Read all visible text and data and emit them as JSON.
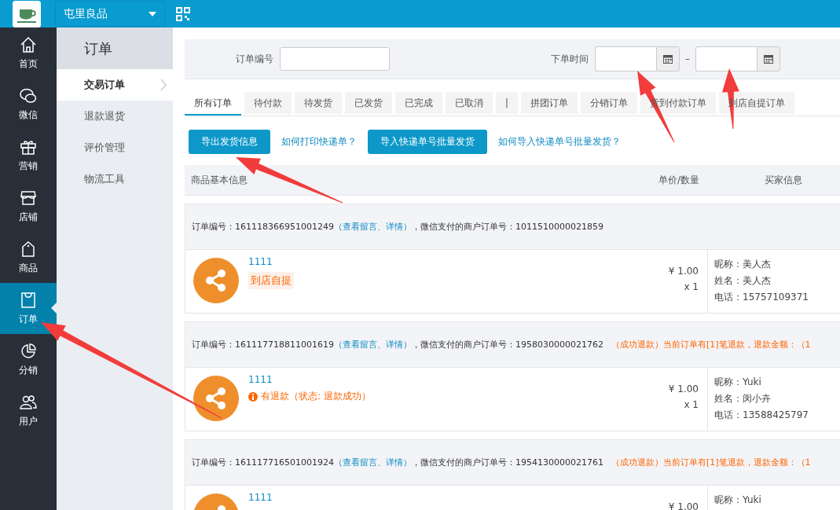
{
  "topbar": {
    "shop_name": "屯里良品"
  },
  "nav": [
    {
      "label": "首页",
      "kind": "home",
      "selected": false
    },
    {
      "label": "微信",
      "kind": "chat",
      "selected": false
    },
    {
      "label": "营销",
      "kind": "gift",
      "selected": false
    },
    {
      "label": "店铺",
      "kind": "store",
      "selected": false
    },
    {
      "label": "商品",
      "kind": "tag",
      "selected": false
    },
    {
      "label": "订单",
      "kind": "bag",
      "selected": true
    },
    {
      "label": "分销",
      "kind": "pie",
      "selected": false
    },
    {
      "label": "用户",
      "kind": "users",
      "selected": false
    }
  ],
  "subnav": {
    "title": "订单",
    "items": [
      {
        "label": "交易订单",
        "selected": true
      },
      {
        "label": "退款退货",
        "selected": false
      },
      {
        "label": "评价管理",
        "selected": false
      },
      {
        "label": "物流工具",
        "selected": false
      }
    ]
  },
  "filters": {
    "order_no_label": "订单编号",
    "time_label": "下单时间",
    "range_separator": "–"
  },
  "tabs": [
    {
      "label": "所有订单",
      "selected": true
    },
    {
      "label": "待付款",
      "selected": false
    },
    {
      "label": "待发货",
      "selected": false
    },
    {
      "label": "已发货",
      "selected": false
    },
    {
      "label": "已完成",
      "selected": false
    },
    {
      "label": "已取消",
      "selected": false
    },
    {
      "label": "|",
      "selected": false
    },
    {
      "label": "拼团订单",
      "selected": false
    },
    {
      "label": "分销订单",
      "selected": false
    },
    {
      "label": "货到付款订单",
      "selected": false
    },
    {
      "label": "到店自提订单",
      "selected": false
    }
  ],
  "actions": [
    {
      "kind": "button",
      "label": "导出发货信息"
    },
    {
      "kind": "link",
      "label": "如何打印快递单？"
    },
    {
      "kind": "button",
      "label": "导入快递单号批量发货"
    },
    {
      "kind": "link",
      "label": "如何导入快递单号批量发货？"
    }
  ],
  "columns": [
    "商品基本信息",
    "单价/数量",
    "买家信息"
  ],
  "orders": [
    {
      "order_no": "订单编号：161118366951001249",
      "detail_link": "（查看留言、详情）",
      "pay_no": "，微信支付的商户订单号：1011510000021859",
      "product": "1111",
      "tag": {
        "kind": "pickup",
        "text": "到店自提"
      },
      "price": "¥ 1.00",
      "qty": "x 1",
      "buyer": [
        "昵称：美人杰",
        "姓名：美人杰",
        "电话：15757109371"
      ]
    },
    {
      "order_no": "订单编号：161117718811001619",
      "detail_link": "（查看留言、详情）",
      "pay_no": "，微信支付的商户订单号：1958030000021762",
      "refund_note": "（成功退款）当前订单有[1]笔退款，退款金额：（1",
      "product": "1111",
      "tag": {
        "kind": "refund",
        "text": "有退款（状态: 退款成功）"
      },
      "price": "¥ 1.00",
      "qty": "x 1",
      "buyer": [
        "昵称：Yuki",
        "姓名：闵小卉",
        "电话：13588425797"
      ]
    },
    {
      "order_no": "订单编号：161117716501001924",
      "detail_link": "（查看留言、详情）",
      "pay_no": "，微信支付的商户订单号：1954130000021761",
      "refund_note": "（成功退款）当前订单有[1]笔退款，退款金额：（1",
      "product": "1111",
      "price": "¥ 1.00",
      "buyer": [
        "昵称：Yuki"
      ]
    }
  ]
}
